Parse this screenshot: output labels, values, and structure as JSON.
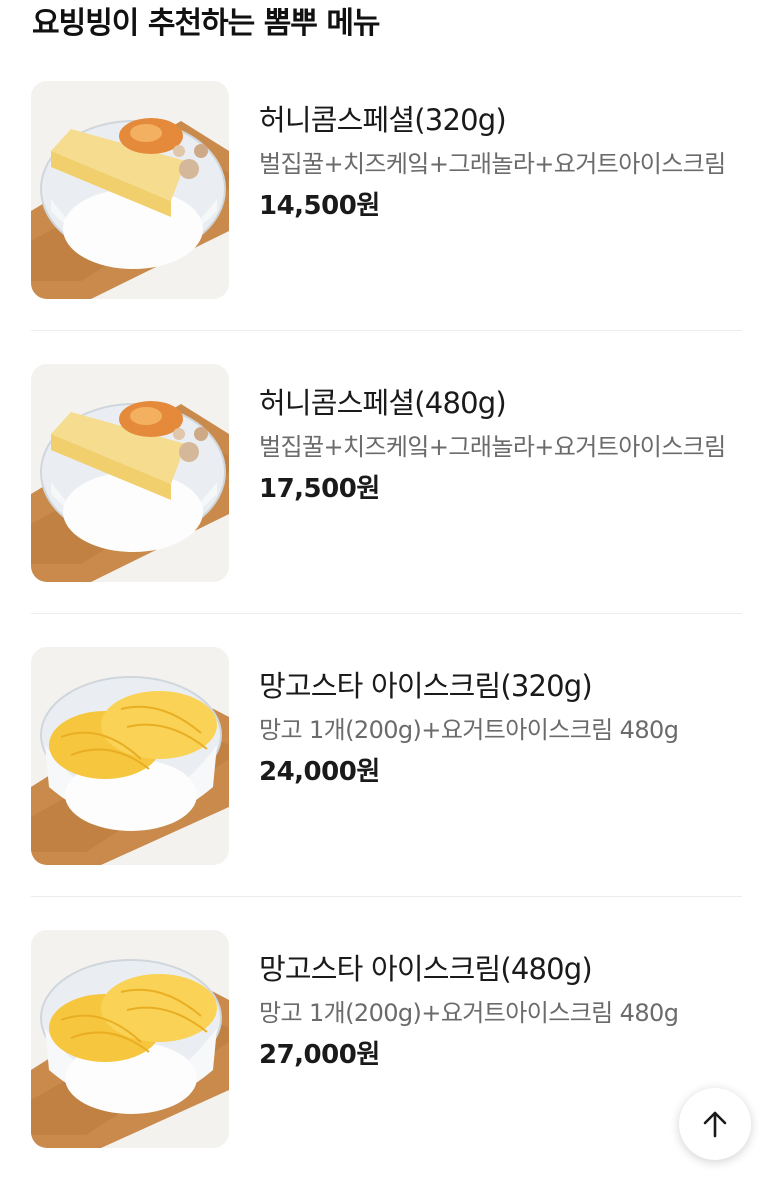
{
  "section": {
    "title": "요빙빙이 추천하는 뽐뿌 메뉴"
  },
  "menu": {
    "items": [
      {
        "name": "허니콤스페셜(320g)",
        "description": "벌집꿀+치즈케잌+그래놀라+요거트아이스크림",
        "price": "14,500원",
        "image_icon": "honeycomb-cheesecake-yogurt-bowl-icon"
      },
      {
        "name": "허니콤스페셜(480g)",
        "description": "벌집꿀+치즈케잌+그래놀라+요거트아이스크림",
        "price": "17,500원",
        "image_icon": "honeycomb-cheesecake-yogurt-bowl-icon"
      },
      {
        "name": "망고스타 아이스크림(320g)",
        "description": "망고 1개(200g)+요거트아이스크림 480g",
        "price": "24,000원",
        "image_icon": "mango-yogurt-bowl-icon"
      },
      {
        "name": "망고스타 아이스크림(480g)",
        "description": "망고 1개(200g)+요거트아이스크림 480g",
        "price": "27,000원",
        "image_icon": "mango-yogurt-bowl-icon"
      }
    ]
  },
  "scroll_top": {
    "icon": "arrow-up-icon"
  },
  "colors": {
    "text": "#1a1a1a",
    "description": "#6b6b6b",
    "divider": "#ececec",
    "board": "#c98a4b",
    "mango": "#f7c63f",
    "honey": "#e48a3a"
  }
}
